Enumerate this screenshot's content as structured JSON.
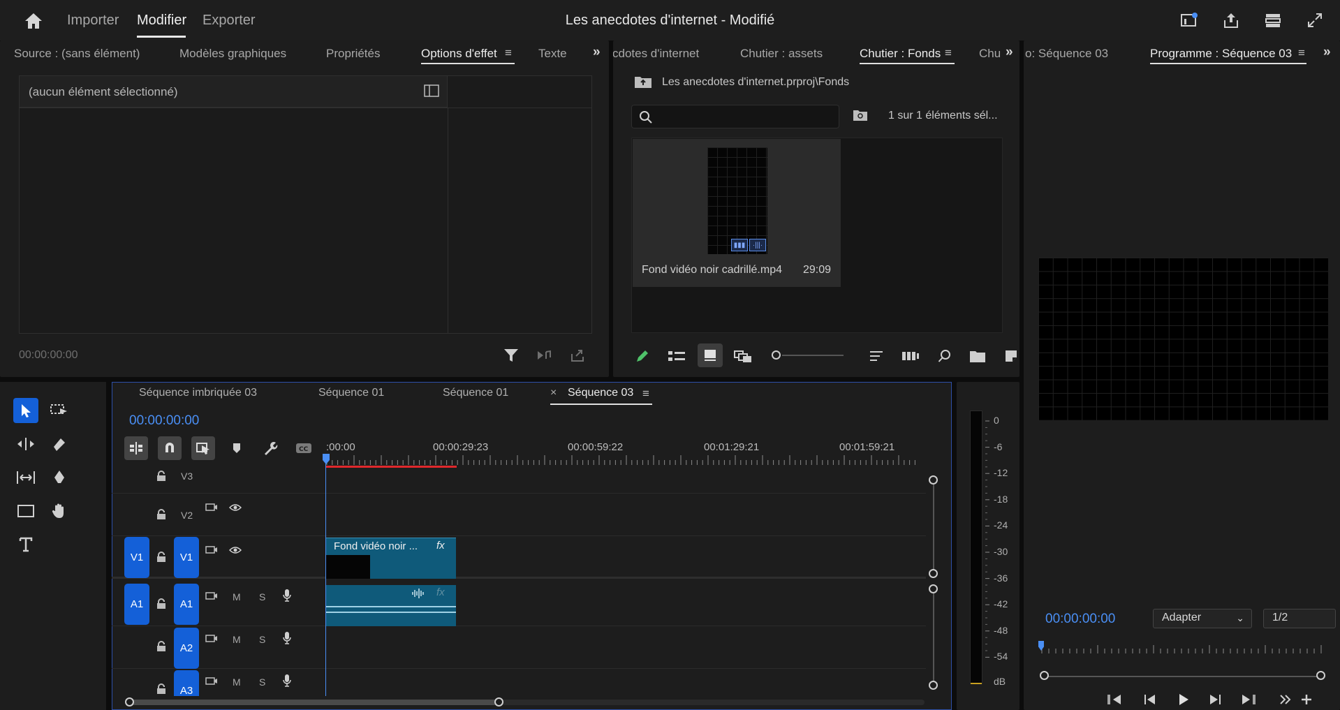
{
  "header": {
    "workspaces": [
      "Importer",
      "Modifier",
      "Exporter"
    ],
    "active_workspace": "Modifier",
    "project_name": "Les anecdotes d'internet",
    "status": " - Modifié"
  },
  "left_panel": {
    "tabs": [
      "Source : (sans élément)",
      "Modèles graphiques",
      "Propriétés",
      "Options d'effet",
      "Texte"
    ],
    "active_tab": "Options d'effet",
    "placeholder": "(aucun élément sélectionné)",
    "timecode": "00:00:00:00"
  },
  "project_panel": {
    "tabs": [
      "cdotes d'internet",
      "Chutier : assets",
      "Chutier : Fonds",
      "Chu"
    ],
    "active_tab": "Chutier : Fonds",
    "path": "Les anecdotes d'internet.prproj\\Fonds",
    "search_value": "",
    "selection_count": "1 sur 1 éléments sél...",
    "items": [
      {
        "name": "Fond vidéo noir cadrillé.mp4",
        "duration": "29:09"
      }
    ],
    "zoom_value": 0
  },
  "program_panel": {
    "tabs": [
      "o: Séquence 03",
      "Programme : Séquence 03"
    ],
    "active_tab": "Programme : Séquence 03",
    "timecode": "00:00:00:00",
    "zoom_option": "Adapter",
    "resolution_option": "1/2"
  },
  "timeline": {
    "tabs": [
      "Séquence imbriquée 03",
      "Séquence 01",
      "Séquence 01",
      "Séquence 03"
    ],
    "active_tab": "Séquence 03",
    "close_glyph": "×",
    "timecode": "00:00:00:00",
    "ruler": [
      ":00:00",
      "00:00:29:23",
      "00:00:59:22",
      "00:01:29:21",
      "00:01:59:21"
    ],
    "video_tracks": [
      {
        "name": "V3",
        "source": ""
      },
      {
        "name": "V2",
        "source": ""
      },
      {
        "name": "V1",
        "source": "V1"
      }
    ],
    "audio_tracks": [
      {
        "name": "A1",
        "source": "A1"
      },
      {
        "name": "A2",
        "source": ""
      },
      {
        "name": "A3",
        "source": ""
      }
    ],
    "mute_label": "M",
    "solo_label": "S",
    "clip_label": "Fond vidéo noir ...",
    "fx_label": "fx"
  },
  "audio_meter": {
    "scale": [
      "0",
      "-6",
      "-12",
      "-18",
      "-24",
      "-30",
      "-36",
      "-42",
      "-48",
      "-54"
    ],
    "unit": "dB"
  },
  "colors": {
    "accent": "#4a8ff5",
    "track_target": "#1460d8",
    "clip": "#0f5a7a",
    "work_area": "#e0282c"
  }
}
